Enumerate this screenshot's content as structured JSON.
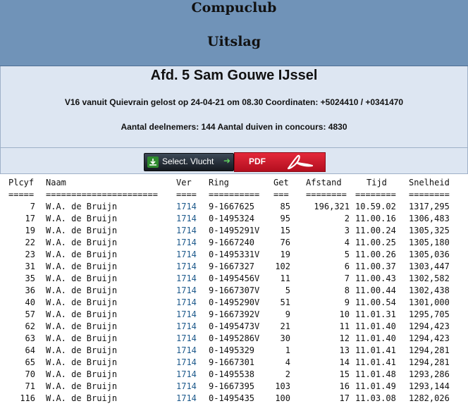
{
  "header": {
    "club": "Compuclub",
    "subtitle": "Uitslag"
  },
  "info": {
    "title": "Afd. 5 Sam Gouwe IJssel",
    "flight": "V16 vanuit Quievrain gelost op 24-04-21 om 08.30 Coordinaten: +5024410 / +0341470",
    "stats": "Aantal deelnemers: 144 Aantal duiven in concours: 4830"
  },
  "buttons": {
    "select_label": "Select. Vlucht",
    "pdf_label": "PDF"
  },
  "colors": {
    "banner": "#7093b8",
    "info_bg": "#dde6f2",
    "ver_link": "#1e5a8c",
    "pdf_red": "#d01e2e"
  },
  "table": {
    "headers": {
      "plcyf": "Plcyf",
      "naam": "Naam",
      "ver": "Ver",
      "ring": "Ring",
      "get": "Get",
      "afstand": "Afstand",
      "tijd": "Tijd",
      "snelheid": "Snelheid"
    },
    "separators": {
      "plcyf": "=====",
      "naam": "======================",
      "ver": "====",
      "ring": "==========",
      "get": "===",
      "afstand": "========",
      "tijd": "========",
      "snelheid": "========"
    },
    "rows": [
      {
        "plcyf": "7",
        "naam": "W.A. de Bruijn",
        "ver": "1714",
        "ring": "9-1667625",
        "get": "85",
        "afstand": "196,321",
        "tijd": "10.59.02",
        "snelheid": "1317,295"
      },
      {
        "plcyf": "17",
        "naam": "W.A. de Bruijn",
        "ver": "1714",
        "ring": "0-1495324",
        "get": "95",
        "afstand": "2",
        "tijd": "11.00.16",
        "snelheid": "1306,483"
      },
      {
        "plcyf": "19",
        "naam": "W.A. de Bruijn",
        "ver": "1714",
        "ring": "0-1495291V",
        "get": "15",
        "afstand": "3",
        "tijd": "11.00.24",
        "snelheid": "1305,325"
      },
      {
        "plcyf": "22",
        "naam": "W.A. de Bruijn",
        "ver": "1714",
        "ring": "9-1667240",
        "get": "76",
        "afstand": "4",
        "tijd": "11.00.25",
        "snelheid": "1305,180"
      },
      {
        "plcyf": "23",
        "naam": "W.A. de Bruijn",
        "ver": "1714",
        "ring": "0-1495331V",
        "get": "19",
        "afstand": "5",
        "tijd": "11.00.26",
        "snelheid": "1305,036"
      },
      {
        "plcyf": "31",
        "naam": "W.A. de Bruijn",
        "ver": "1714",
        "ring": "9-1667327",
        "get": "102",
        "afstand": "6",
        "tijd": "11.00.37",
        "snelheid": "1303,447"
      },
      {
        "plcyf": "35",
        "naam": "W.A. de Bruijn",
        "ver": "1714",
        "ring": "0-1495456V",
        "get": "11",
        "afstand": "7",
        "tijd": "11.00.43",
        "snelheid": "1302,582"
      },
      {
        "plcyf": "36",
        "naam": "W.A. de Bruijn",
        "ver": "1714",
        "ring": "9-1667307V",
        "get": "5",
        "afstand": "8",
        "tijd": "11.00.44",
        "snelheid": "1302,438"
      },
      {
        "plcyf": "40",
        "naam": "W.A. de Bruijn",
        "ver": "1714",
        "ring": "0-1495290V",
        "get": "51",
        "afstand": "9",
        "tijd": "11.00.54",
        "snelheid": "1301,000"
      },
      {
        "plcyf": "57",
        "naam": "W.A. de Bruijn",
        "ver": "1714",
        "ring": "9-1667392V",
        "get": "9",
        "afstand": "10",
        "tijd": "11.01.31",
        "snelheid": "1295,705"
      },
      {
        "plcyf": "62",
        "naam": "W.A. de Bruijn",
        "ver": "1714",
        "ring": "0-1495473V",
        "get": "21",
        "afstand": "11",
        "tijd": "11.01.40",
        "snelheid": "1294,423"
      },
      {
        "plcyf": "63",
        "naam": "W.A. de Bruijn",
        "ver": "1714",
        "ring": "0-1495286V",
        "get": "30",
        "afstand": "12",
        "tijd": "11.01.40",
        "snelheid": "1294,423"
      },
      {
        "plcyf": "64",
        "naam": "W.A. de Bruijn",
        "ver": "1714",
        "ring": "0-1495329",
        "get": "1",
        "afstand": "13",
        "tijd": "11.01.41",
        "snelheid": "1294,281"
      },
      {
        "plcyf": "65",
        "naam": "W.A. de Bruijn",
        "ver": "1714",
        "ring": "9-1667301",
        "get": "4",
        "afstand": "14",
        "tijd": "11.01.41",
        "snelheid": "1294,281"
      },
      {
        "plcyf": "70",
        "naam": "W.A. de Bruijn",
        "ver": "1714",
        "ring": "0-1495538",
        "get": "2",
        "afstand": "15",
        "tijd": "11.01.48",
        "snelheid": "1293,286"
      },
      {
        "plcyf": "71",
        "naam": "W.A. de Bruijn",
        "ver": "1714",
        "ring": "9-1667395",
        "get": "103",
        "afstand": "16",
        "tijd": "11.01.49",
        "snelheid": "1293,144"
      },
      {
        "plcyf": "116",
        "naam": "W.A. de Bruijn",
        "ver": "1714",
        "ring": "0-1495435",
        "get": "100",
        "afstand": "17",
        "tijd": "11.03.08",
        "snelheid": "1282,026"
      }
    ]
  }
}
